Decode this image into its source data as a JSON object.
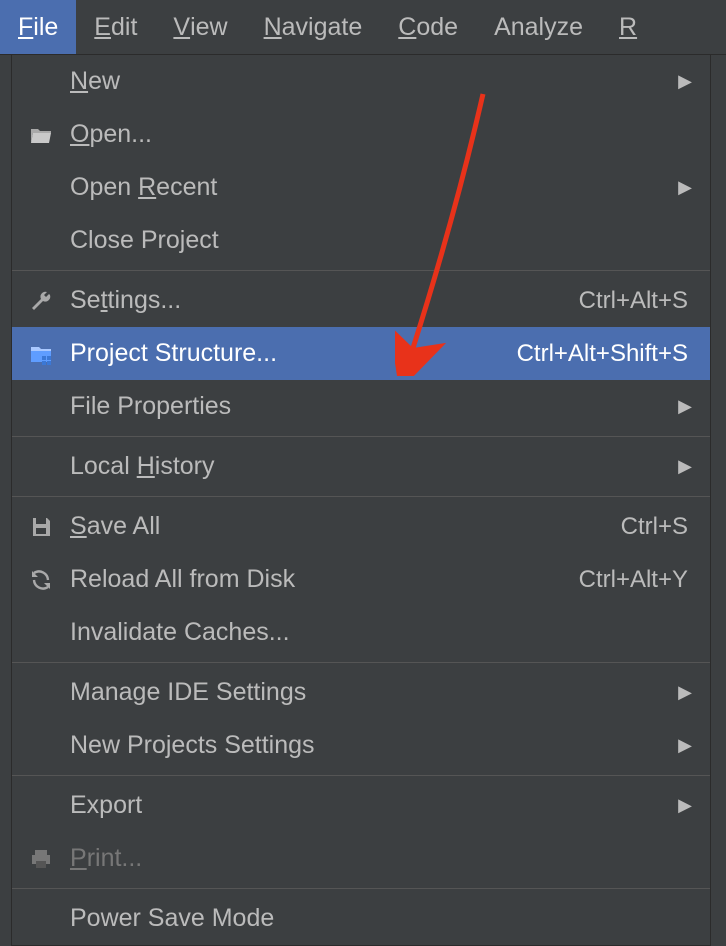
{
  "menubar": {
    "items": [
      {
        "label": "File",
        "mnemonic": "F",
        "active": true
      },
      {
        "label": "Edit",
        "mnemonic": "E"
      },
      {
        "label": "View",
        "mnemonic": "V"
      },
      {
        "label": "Navigate",
        "mnemonic": "N"
      },
      {
        "label": "Code",
        "mnemonic": "C"
      },
      {
        "label": "Analyze",
        "mnemonic": null
      },
      {
        "label": "R",
        "mnemonic": "R"
      }
    ]
  },
  "dropdown": {
    "groups": [
      [
        {
          "label": "New",
          "mnemonic": "N",
          "icon": null,
          "submenu": true
        },
        {
          "label": "Open...",
          "mnemonic": "O",
          "icon": "folder-open-icon"
        },
        {
          "label": "Open Recent",
          "mnemonic": "R",
          "icon": null,
          "submenu": true
        },
        {
          "label": "Close Project",
          "mnemonic": "j",
          "icon": null
        }
      ],
      [
        {
          "label": "Settings...",
          "mnemonic": "t",
          "icon": "wrench-icon",
          "shortcut": "Ctrl+Alt+S"
        },
        {
          "label": "Project Structure...",
          "mnemonic": null,
          "icon": "project-structure-icon",
          "shortcut": "Ctrl+Alt+Shift+S",
          "highlighted": true
        },
        {
          "label": "File Properties",
          "mnemonic": null,
          "icon": null,
          "submenu": true
        }
      ],
      [
        {
          "label": "Local History",
          "mnemonic": "H",
          "icon": null,
          "submenu": true
        }
      ],
      [
        {
          "label": "Save All",
          "mnemonic": "S",
          "icon": "save-icon",
          "shortcut": "Ctrl+S"
        },
        {
          "label": "Reload All from Disk",
          "mnemonic": null,
          "icon": "reload-icon",
          "shortcut": "Ctrl+Alt+Y"
        },
        {
          "label": "Invalidate Caches...",
          "mnemonic": null,
          "icon": null
        }
      ],
      [
        {
          "label": "Manage IDE Settings",
          "mnemonic": null,
          "icon": null,
          "submenu": true
        },
        {
          "label": "New Projects Settings",
          "mnemonic": null,
          "icon": null,
          "submenu": true
        }
      ],
      [
        {
          "label": "Export",
          "mnemonic": null,
          "icon": null,
          "submenu": true
        },
        {
          "label": "Print...",
          "mnemonic": "P",
          "icon": "print-icon",
          "disabled": true
        }
      ],
      [
        {
          "label": "Power Save Mode",
          "mnemonic": null,
          "icon": null
        }
      ]
    ]
  },
  "colors": {
    "bg": "#3c3f41",
    "highlight": "#4b6eaf",
    "text": "#bbbbbb",
    "disabled": "#777777",
    "arrow": "#e8321a"
  }
}
